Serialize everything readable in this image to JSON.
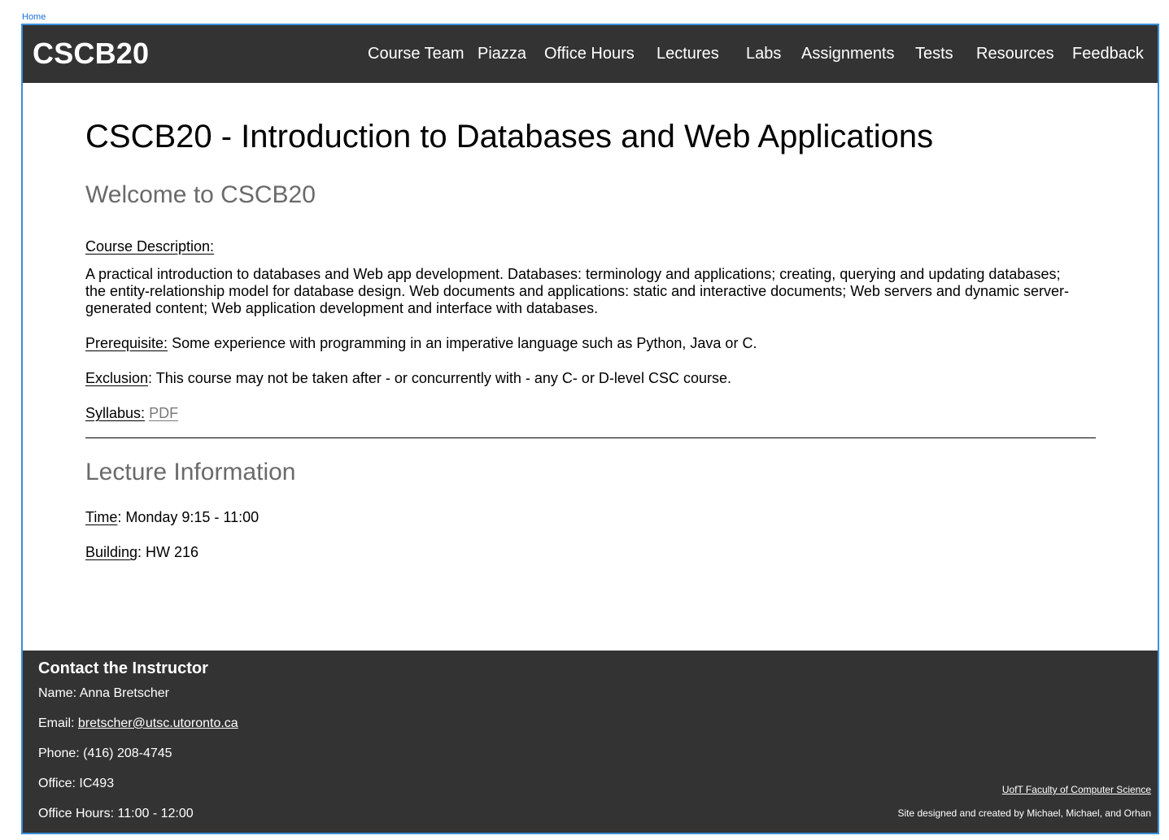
{
  "home_link": "Home",
  "nav": {
    "brand": "CSCB20",
    "items": [
      "Course Team",
      "Piazza",
      "Office Hours",
      "Lectures",
      "Labs",
      "Assignments",
      "Tests",
      "Resources",
      "Feedback"
    ]
  },
  "main": {
    "title": "CSCB20 - Introduction to Databases and Web Applications",
    "welcome_heading": "Welcome to CSCB20",
    "course_description_label": "Course Description:",
    "course_description": "A practical introduction to databases and Web app development. Databases: terminology and applications; creating, querying and updating databases; the entity-relationship model for database design. Web documents and applications: static and interactive documents; Web servers and dynamic server-generated content; Web application development and interface with databases.",
    "prerequisite_label": "Prerequisite:",
    "prerequisite_text": " Some experience with programming in an imperative language such as Python, Java or C.",
    "exclusion_label": "Exclusion",
    "exclusion_text": ": This course may not be taken after - or concurrently with - any C- or D-level CSC course.",
    "syllabus_label": "Syllabus:",
    "syllabus_link": "PDF",
    "lecture_heading": "Lecture Information",
    "time_label": "Time",
    "time_text": ": Monday 9:15 - 11:00",
    "building_label": "Building",
    "building_text": ": HW 216"
  },
  "footer": {
    "title": "Contact the Instructor",
    "name": "Name: Anna Bretscher",
    "email_label": "Email: ",
    "email": "bretscher@utsc.utoronto.ca",
    "phone": "Phone: (416) 208-4745",
    "office": "Office: IC493",
    "office_hours": "Office Hours: 11:00 - 12:00",
    "uoft_link": "UofT Faculty of Computer Science",
    "credits": "Site designed and created by Michael, Michael, and Orhan"
  },
  "colors": {
    "nav_bg": "#333333",
    "frame_border": "#3b8fdc",
    "section_heading": "#6a6a6a",
    "home_link": "#1a6fd6"
  }
}
